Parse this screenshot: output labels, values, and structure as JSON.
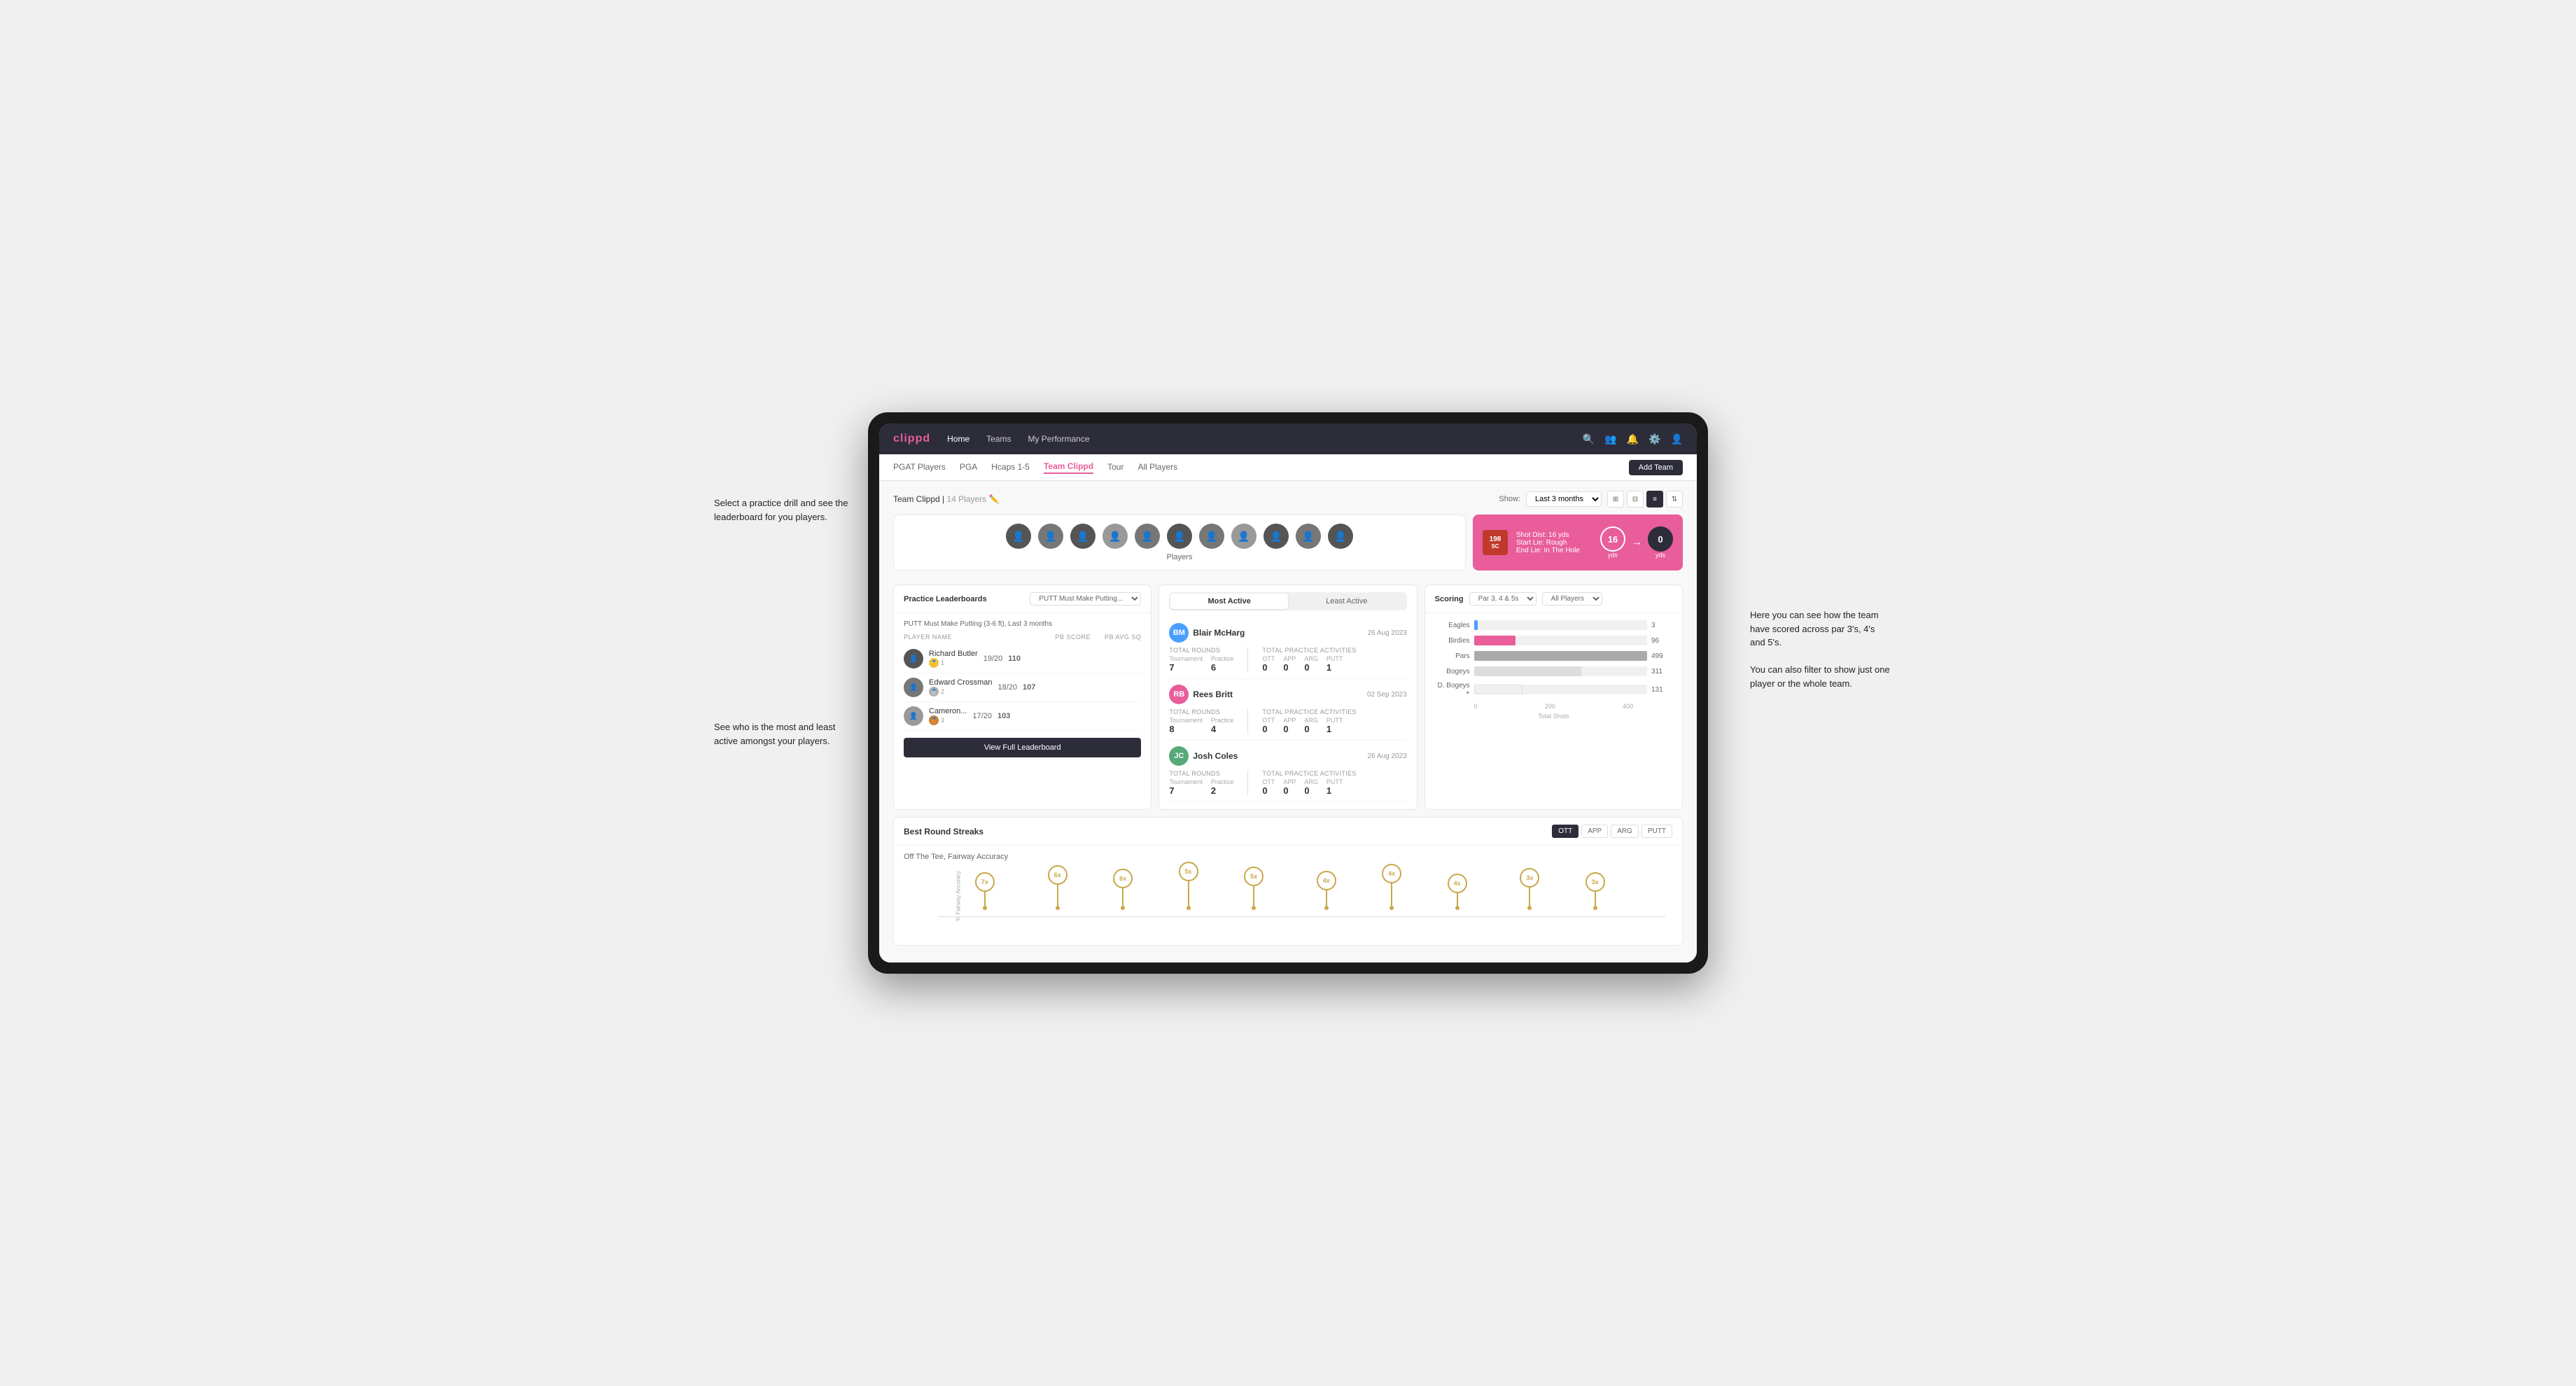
{
  "annotations": {
    "top_left": "Select a practice drill and see the leaderboard for you players.",
    "bottom_left": "See who is the most and least active amongst your players.",
    "right_top": "Here you can see how the team have scored across par 3's, 4's and 5's.",
    "right_bottom": "You can also filter to show just one player or the whole team."
  },
  "nav": {
    "logo": "clippd",
    "items": [
      "Home",
      "Teams",
      "My Performance"
    ],
    "icons": [
      "search",
      "people",
      "bell",
      "settings",
      "user"
    ]
  },
  "sub_nav": {
    "items": [
      "PGAT Players",
      "PGA",
      "Hcaps 1-5",
      "Team Clippd",
      "Tour",
      "All Players"
    ],
    "active": "Team Clippd",
    "add_team_label": "Add Team"
  },
  "team_header": {
    "title": "Team Clippd",
    "player_count": "14 Players",
    "show_label": "Show:",
    "show_value": "Last 3 months",
    "views": [
      "grid-small",
      "grid-large",
      "list",
      "filter"
    ]
  },
  "players": {
    "label": "Players",
    "avatars": [
      "A",
      "B",
      "C",
      "D",
      "E",
      "F",
      "G",
      "H",
      "I",
      "J",
      "K"
    ]
  },
  "shot_info": {
    "badge": "198",
    "badge_sub": "SC",
    "lines": [
      "Shot Dist: 16 yds",
      "Start Lie: Rough",
      "End Lie: In The Hole"
    ],
    "circle_left_value": "16",
    "circle_left_label": "yds",
    "circle_right_value": "0",
    "circle_right_label": "yds"
  },
  "practice_leaderboards": {
    "title": "Practice Leaderboards",
    "dropdown": "PUTT Must Make Putting...",
    "subtitle": "PUTT Must Make Putting (3-6 ft), Last 3 months",
    "col_player": "PLAYER NAME",
    "col_pb": "PB SCORE",
    "col_avg": "PB AVG SQ",
    "players": [
      {
        "name": "Richard Butler",
        "score": "19/20",
        "avg": "110",
        "rank": 1,
        "medal": "gold"
      },
      {
        "name": "Edward Crossman",
        "score": "18/20",
        "avg": "107",
        "rank": 2,
        "medal": "silver"
      },
      {
        "name": "Cameron...",
        "score": "17/20",
        "avg": "103",
        "rank": 3,
        "medal": "bronze"
      }
    ],
    "view_full_label": "View Full Leaderboard"
  },
  "activity": {
    "tab_active": "Most Active",
    "tab_inactive": "Least Active",
    "players": [
      {
        "name": "Blair McHarg",
        "date": "26 Aug 2023",
        "avatar_initials": "BM",
        "total_rounds_label": "Total Rounds",
        "tournament": 7,
        "practice": 6,
        "total_practice_label": "Total Practice Activities",
        "ott": 0,
        "app": 0,
        "arg": 0,
        "putt": 1
      },
      {
        "name": "Rees Britt",
        "date": "02 Sep 2023",
        "avatar_initials": "RB",
        "total_rounds_label": "Total Rounds",
        "tournament": 8,
        "practice": 4,
        "total_practice_label": "Total Practice Activities",
        "ott": 0,
        "app": 0,
        "arg": 0,
        "putt": 1
      },
      {
        "name": "Josh Coles",
        "date": "26 Aug 2023",
        "avatar_initials": "JC",
        "total_rounds_label": "Total Rounds",
        "tournament": 7,
        "practice": 2,
        "total_practice_label": "Total Practice Activities",
        "ott": 0,
        "app": 0,
        "arg": 0,
        "putt": 1
      }
    ]
  },
  "scoring": {
    "title": "Scoring",
    "filter_par": "Par 3, 4 & 5s",
    "filter_players": "All Players",
    "bars": [
      {
        "label": "Eagles",
        "value": 3,
        "max": 499,
        "class": "eagles"
      },
      {
        "label": "Birdies",
        "value": 96,
        "max": 499,
        "class": "birdies"
      },
      {
        "label": "Pars",
        "value": 499,
        "max": 499,
        "class": "pars"
      },
      {
        "label": "Bogeys",
        "value": 311,
        "max": 499,
        "class": "bogeys"
      },
      {
        "label": "D. Bogeys +",
        "value": 131,
        "max": 499,
        "class": "dbogeys"
      }
    ],
    "x_labels": [
      "0",
      "200",
      "400"
    ],
    "x_axis_label": "Total Shots"
  },
  "streaks": {
    "title": "Best Round Streaks",
    "tabs": [
      "OTT",
      "APP",
      "ARG",
      "PUTT"
    ],
    "active_tab": "OTT",
    "subtitle": "Off The Tee, Fairway Accuracy",
    "pins": [
      {
        "value": "7x",
        "left_pct": 7
      },
      {
        "value": "6x",
        "left_pct": 17
      },
      {
        "value": "6x",
        "left_pct": 26
      },
      {
        "value": "5x",
        "left_pct": 36
      },
      {
        "value": "5x",
        "left_pct": 45
      },
      {
        "value": "4x",
        "left_pct": 55
      },
      {
        "value": "4x",
        "left_pct": 63
      },
      {
        "value": "4x",
        "left_pct": 71
      },
      {
        "value": "3x",
        "left_pct": 81
      },
      {
        "value": "3x",
        "left_pct": 90
      }
    ]
  }
}
